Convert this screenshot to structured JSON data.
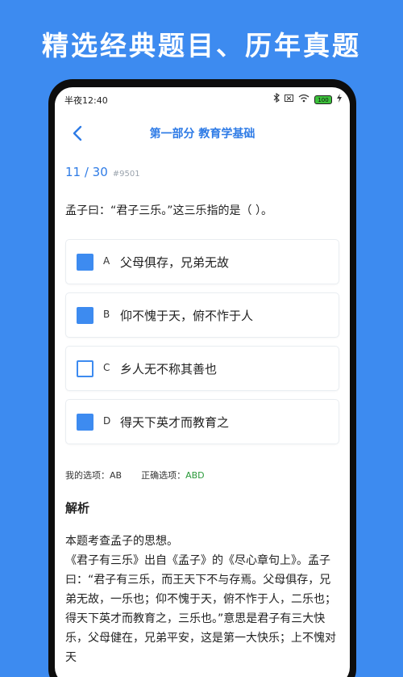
{
  "promo": {
    "headline": "精选经典题目、历年真题"
  },
  "status": {
    "time": "半夜12:40",
    "battery": "100"
  },
  "nav": {
    "title": "第一部分  教育学基础"
  },
  "progress": {
    "count": "11 / 30",
    "id": "#9501"
  },
  "question": {
    "text": "孟子曰：“君子三乐。”这三乐指的是（  ）。"
  },
  "options": [
    {
      "letter": "A",
      "text": "父母俱存，兄弟无故",
      "checked": true
    },
    {
      "letter": "B",
      "text": "仰不愧于天，俯不怍于人",
      "checked": true
    },
    {
      "letter": "C",
      "text": "乡人无不称其善也",
      "checked": false
    },
    {
      "letter": "D",
      "text": "得天下英才而教育之",
      "checked": true
    }
  ],
  "answers": {
    "mine_label": "我的选项：",
    "mine": "AB",
    "correct_label": "正确选项：",
    "correct": "ABD"
  },
  "analysis": {
    "title": "解析",
    "body": "本题考查孟子的思想。\n《君子有三乐》出自《孟子》的《尽心章句上》。孟子曰：“君子有三乐，而王天下不与存焉。父母俱存，兄弟无故，一乐也；仰不愧于天，俯不怍于人，二乐也；得天下英才而教育之，三乐也。”意思是君子有三大快乐，父母健在，兄弟平安，这是第一大快乐；上不愧对天"
  },
  "colors": {
    "accent": "#3d8bf0",
    "title_blue": "#2e7be6",
    "correct_green": "#2a9a3a"
  }
}
